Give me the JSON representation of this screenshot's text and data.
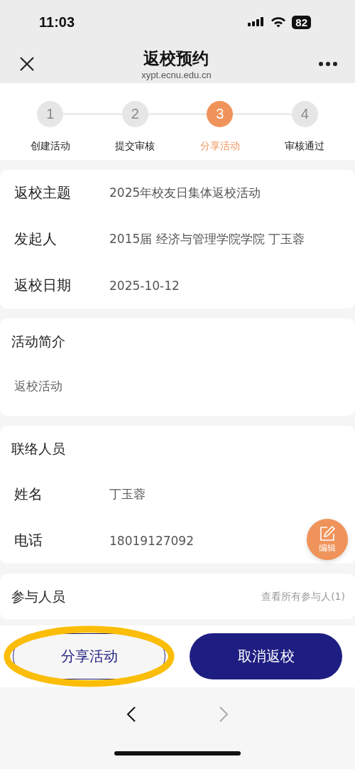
{
  "status_bar": {
    "time": "11:03",
    "battery": "82"
  },
  "nav": {
    "title": "返校预约",
    "url": "xypt.ecnu.edu.cn"
  },
  "steps": [
    {
      "number": "1",
      "label": "创建活动",
      "selected": false
    },
    {
      "number": "2",
      "label": "提交审核",
      "selected": false
    },
    {
      "number": "3",
      "label": "分享活动",
      "selected": true
    },
    {
      "number": "4",
      "label": "审核通过",
      "selected": false
    }
  ],
  "details": [
    {
      "label": "返校主题",
      "value": "2025年校友日集体返校活动"
    },
    {
      "label": "发起人",
      "value": "2015届 经济与管理学院学院 丁玉蓉"
    },
    {
      "label": "返校日期",
      "value": "2025-10-12"
    }
  ],
  "intro": {
    "title": "活动简介",
    "text": "返校活动"
  },
  "contact": {
    "title": "联络人员",
    "rows": [
      {
        "label": "姓名",
        "value": "丁玉蓉"
      },
      {
        "label": "电话",
        "value": "18019127092"
      }
    ]
  },
  "edit_button": {
    "label": "编辑"
  },
  "participants": {
    "title": "参与人员",
    "link": "查看所有参与人(1)"
  },
  "buttons": [
    {
      "label": "分享活动",
      "kind": "outline",
      "highlighted": true
    },
    {
      "label": "取消返校",
      "kind": "filled",
      "highlighted": false
    }
  ]
}
